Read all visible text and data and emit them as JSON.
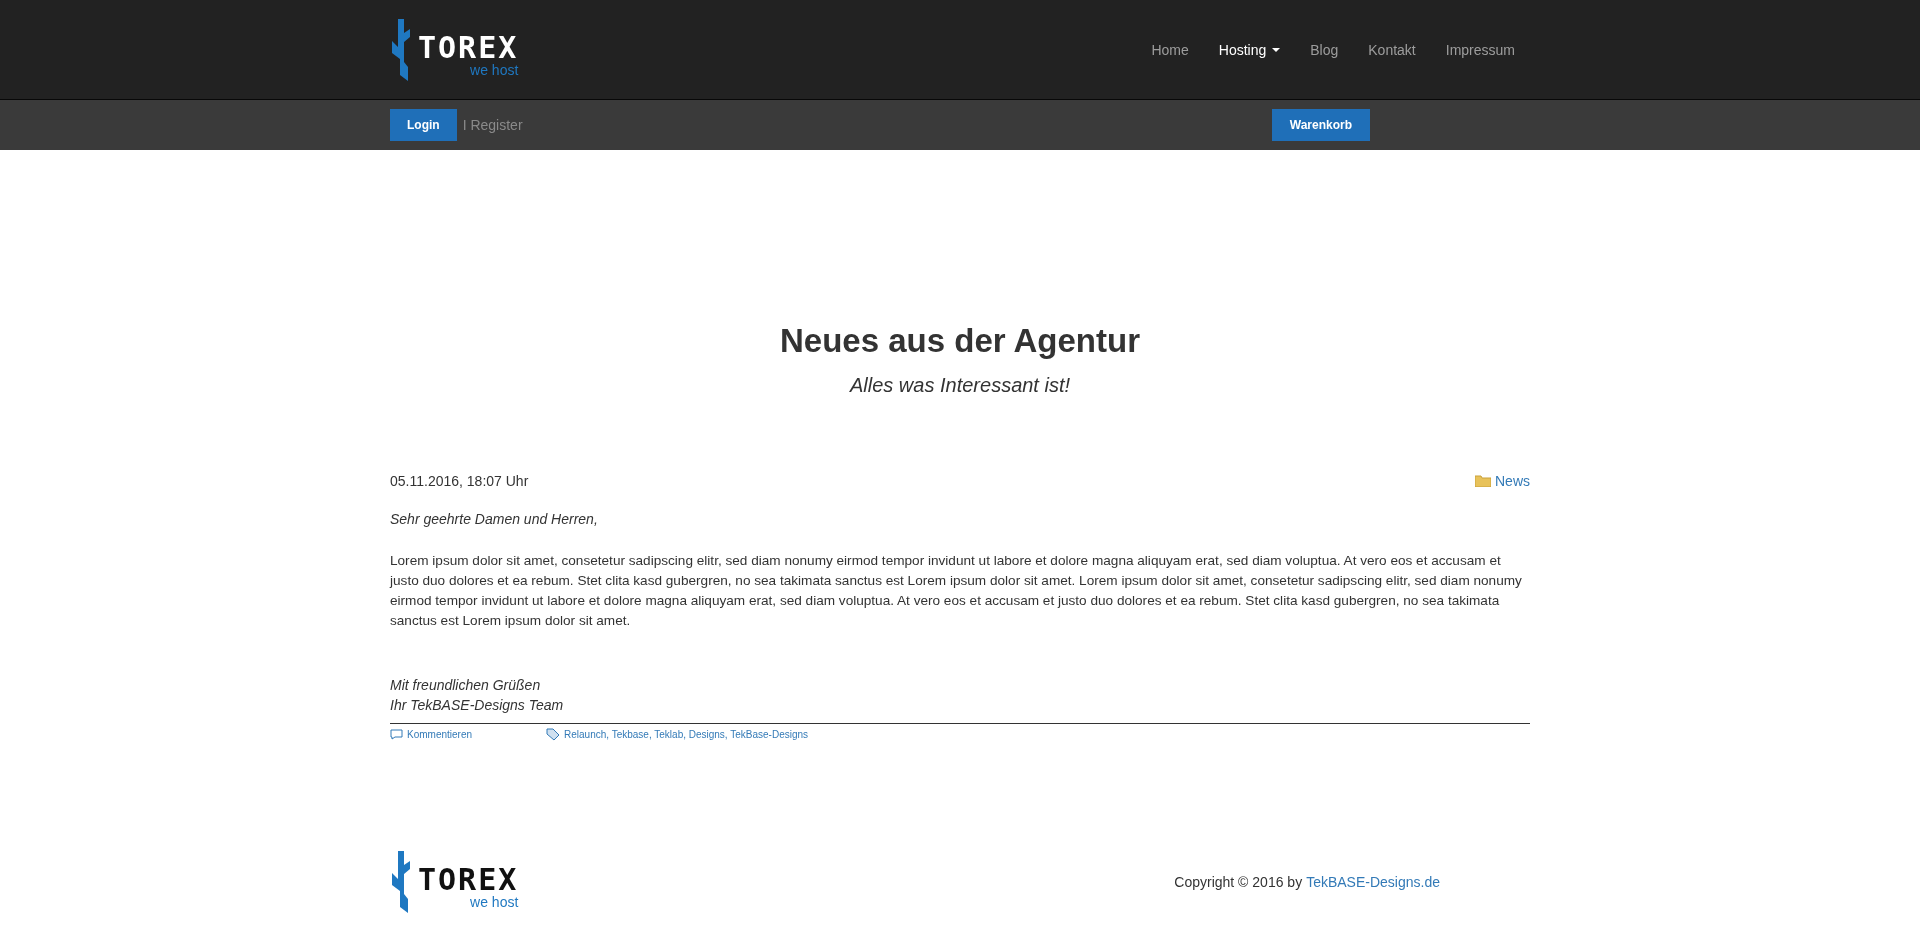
{
  "header": {
    "logo": {
      "name": "TOREX",
      "tagline": "we host"
    },
    "nav": [
      {
        "label": "Home",
        "selected": false,
        "dropdown": false
      },
      {
        "label": "Hosting",
        "selected": true,
        "dropdown": true
      },
      {
        "label": "Blog",
        "selected": false,
        "dropdown": false
      },
      {
        "label": "Kontakt",
        "selected": false,
        "dropdown": false
      },
      {
        "label": "Impressum",
        "selected": false,
        "dropdown": false
      }
    ]
  },
  "subbar": {
    "login": "Login",
    "register": "I Register",
    "cart": "Warenkorb"
  },
  "page": {
    "title": "Neues aus der Agentur",
    "subtitle": "Alles was Interessant ist!"
  },
  "post": {
    "date": "05.11.2016, 18:07 Uhr",
    "category": "News",
    "greeting": "Sehr geehrte Damen und Herren,",
    "body": "Lorem ipsum dolor sit amet, consetetur sadipscing elitr, sed diam nonumy eirmod tempor invidunt ut labore et dolore magna aliquyam erat, sed diam voluptua. At vero eos et accusam et justo duo dolores et ea rebum. Stet clita kasd gubergren, no sea takimata sanctus est Lorem ipsum dolor sit amet. Lorem ipsum dolor sit amet, consetetur sadipscing elitr, sed diam nonumy eirmod tempor invidunt ut labore et dolore magna aliquyam erat, sed diam voluptua. At vero eos et accusam et justo duo dolores et ea rebum. Stet clita kasd gubergren, no sea takimata sanctus est Lorem ipsum dolor sit amet.",
    "closing": [
      "Mit freundlichen Grüßen",
      "Ihr TekBASE-Designs Team"
    ],
    "comment_link": "Kommentieren",
    "tags": "Relaunch, Tekbase, Teklab, Designs, TekBase-Designs"
  },
  "footer": {
    "logo": {
      "name": "TOREX",
      "tagline": "we host"
    },
    "copyright": "Copyright © 2016 by",
    "copyright_link": "TekBASE-Designs.de"
  }
}
